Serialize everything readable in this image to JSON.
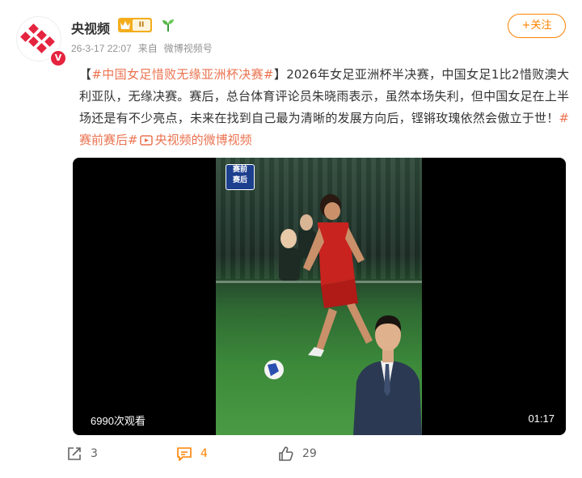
{
  "header": {
    "username": "央视频",
    "vip_level": "II",
    "timestamp": "26-3-17 22:07",
    "source_prefix": "来自",
    "source": "微博视频号",
    "follow_label": "+关注"
  },
  "post": {
    "hashtag": "#中国女足惜败无缘亚洲杯决赛#",
    "bracket_open": "【",
    "bracket_close": "】",
    "body": "2026年女足亚洲杯半决赛，中国女足1比2惜败澳大利亚队，无缘决赛。赛后，总台体育评论员朱晓雨表示，虽然本场失利，但中国女足在上半场还是有不少亮点，未来在找到自己最为清晰的发展方向后，铿锵玫瑰依然会傲立于世！",
    "hashtag2": "#赛前赛后#",
    "video_link": "央视频的微博视频"
  },
  "video": {
    "views": "6990次观看",
    "duration": "01:17",
    "badge_line1": "赛前",
    "badge_line2": "赛后"
  },
  "actions": {
    "repost_count": "3",
    "comment_count": "4",
    "like_count": "29"
  },
  "colors": {
    "accent": "#ff8200",
    "tag": "#eb7350",
    "brand_red": "#e5243f"
  }
}
